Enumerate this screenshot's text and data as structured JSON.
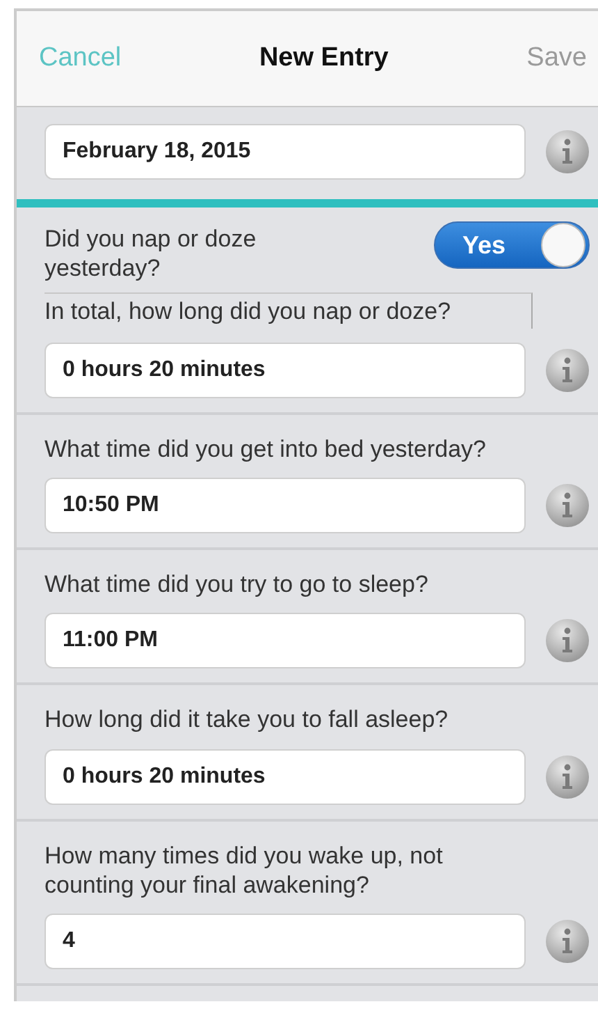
{
  "nav": {
    "cancel": "Cancel",
    "title": "New Entry",
    "save": "Save",
    "save_disabled": true
  },
  "date": {
    "value": "February 18, 2015"
  },
  "sections": [
    {
      "kind": "toggle",
      "question": "Did you nap or doze yesterday?",
      "toggle": {
        "label": "Yes",
        "on": true
      },
      "followup": "In total, how long did you nap or doze?",
      "value": "0 hours 20 minutes"
    },
    {
      "kind": "field",
      "question": "What time did you get into bed yesterday?",
      "value": "10:50 PM"
    },
    {
      "kind": "field",
      "question": "What time did you try to go to sleep?",
      "value": "11:00 PM"
    },
    {
      "kind": "field",
      "question": "How long did it take you to fall asleep?",
      "value": "0 hours 20 minutes"
    },
    {
      "kind": "field",
      "question": "How many times did you wake up, not counting your final awakening?",
      "value": "4"
    }
  ]
}
